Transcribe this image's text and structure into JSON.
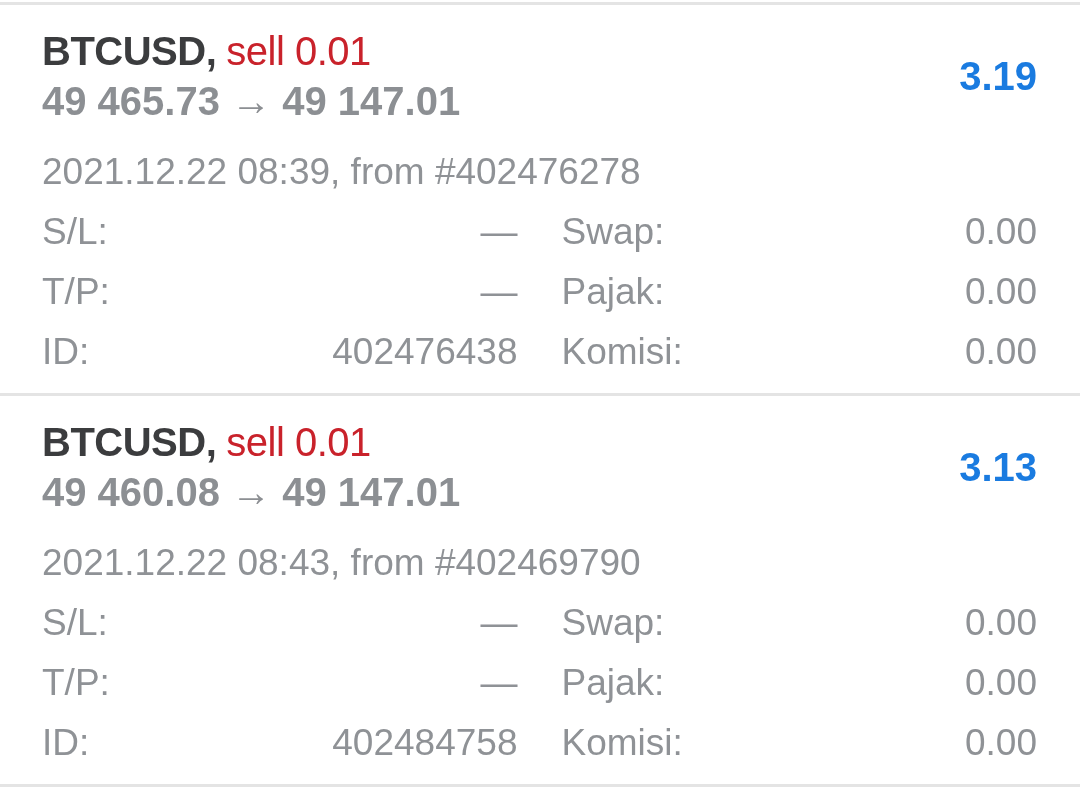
{
  "trades": [
    {
      "symbol": "BTCUSD,",
      "order": "sell 0.01",
      "kind": "sell",
      "prices": "49 465.73 → 49 147.01",
      "profit": "3.19",
      "time": "2021.12.22 08:39, from #402476278",
      "fields": [
        {
          "label": "S/L:",
          "value": "—"
        },
        {
          "label": "Swap:",
          "value": "0.00"
        },
        {
          "label": "T/P:",
          "value": "—"
        },
        {
          "label": "Pajak:",
          "value": "0.00"
        },
        {
          "label": "ID:",
          "value": "402476438"
        },
        {
          "label": "Komisi:",
          "value": "0.00"
        }
      ]
    },
    {
      "symbol": "BTCUSD,",
      "order": "sell 0.01",
      "kind": "sell",
      "prices": "49 460.08 → 49 147.01",
      "profit": "3.13",
      "time": "2021.12.22 08:43, from #402469790",
      "fields": [
        {
          "label": "S/L:",
          "value": "—"
        },
        {
          "label": "Swap:",
          "value": "0.00"
        },
        {
          "label": "T/P:",
          "value": "—"
        },
        {
          "label": "Pajak:",
          "value": "0.00"
        },
        {
          "label": "ID:",
          "value": "402484758"
        },
        {
          "label": "Komisi:",
          "value": "0.00"
        }
      ]
    }
  ]
}
